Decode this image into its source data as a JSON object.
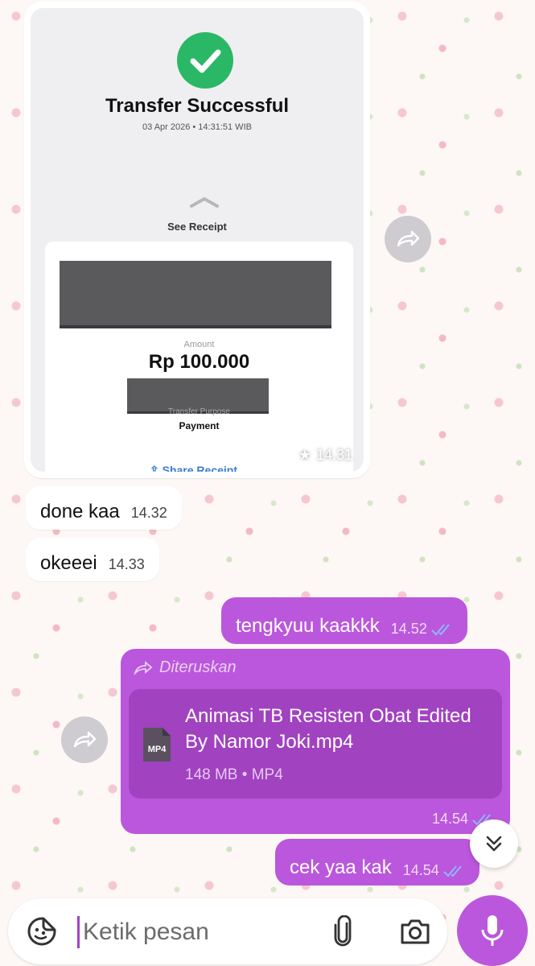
{
  "messages": {
    "receipt_image": {
      "title": "Transfer Successful",
      "date": "03 Apr 2026 • 14:31:51 WIB",
      "see_receipt": "See Receipt",
      "amount_label": "Amount",
      "amount": "Rp 100.000",
      "purpose_label": "Transfer Purpose",
      "purpose": "Payment",
      "share": "Share Receipt",
      "time": "14.31",
      "starred": true
    },
    "done": {
      "text": "done kaa",
      "time": "14.32"
    },
    "okeeei": {
      "text": "okeeei",
      "time": "14.33"
    },
    "tengkyuu": {
      "text": "tengkyuu kaakkk",
      "time": "14.52"
    },
    "forwarded_file": {
      "forwarded_label": "Diteruskan",
      "file_name": "Animasi TB Resisten Obat Edited By Namor Joki.mp4",
      "file_meta": "148 MB • MP4",
      "file_type": "MP4",
      "time": "14.54"
    },
    "cek": {
      "text": "cek yaa kak",
      "time": "14.54"
    }
  },
  "input": {
    "placeholder": "Ketik pesan"
  },
  "icons": {
    "sticker": "sticker-icon",
    "attach": "paperclip-icon",
    "camera": "camera-icon",
    "mic": "microphone-icon",
    "forward": "forward-icon",
    "scroll_down": "double-chevron-down-icon"
  },
  "colors": {
    "outgoing_bubble": "#bb57dc",
    "incoming_bubble": "#ffffff",
    "success_green": "#2ab866",
    "read_ticks": "#7aa8ff"
  }
}
